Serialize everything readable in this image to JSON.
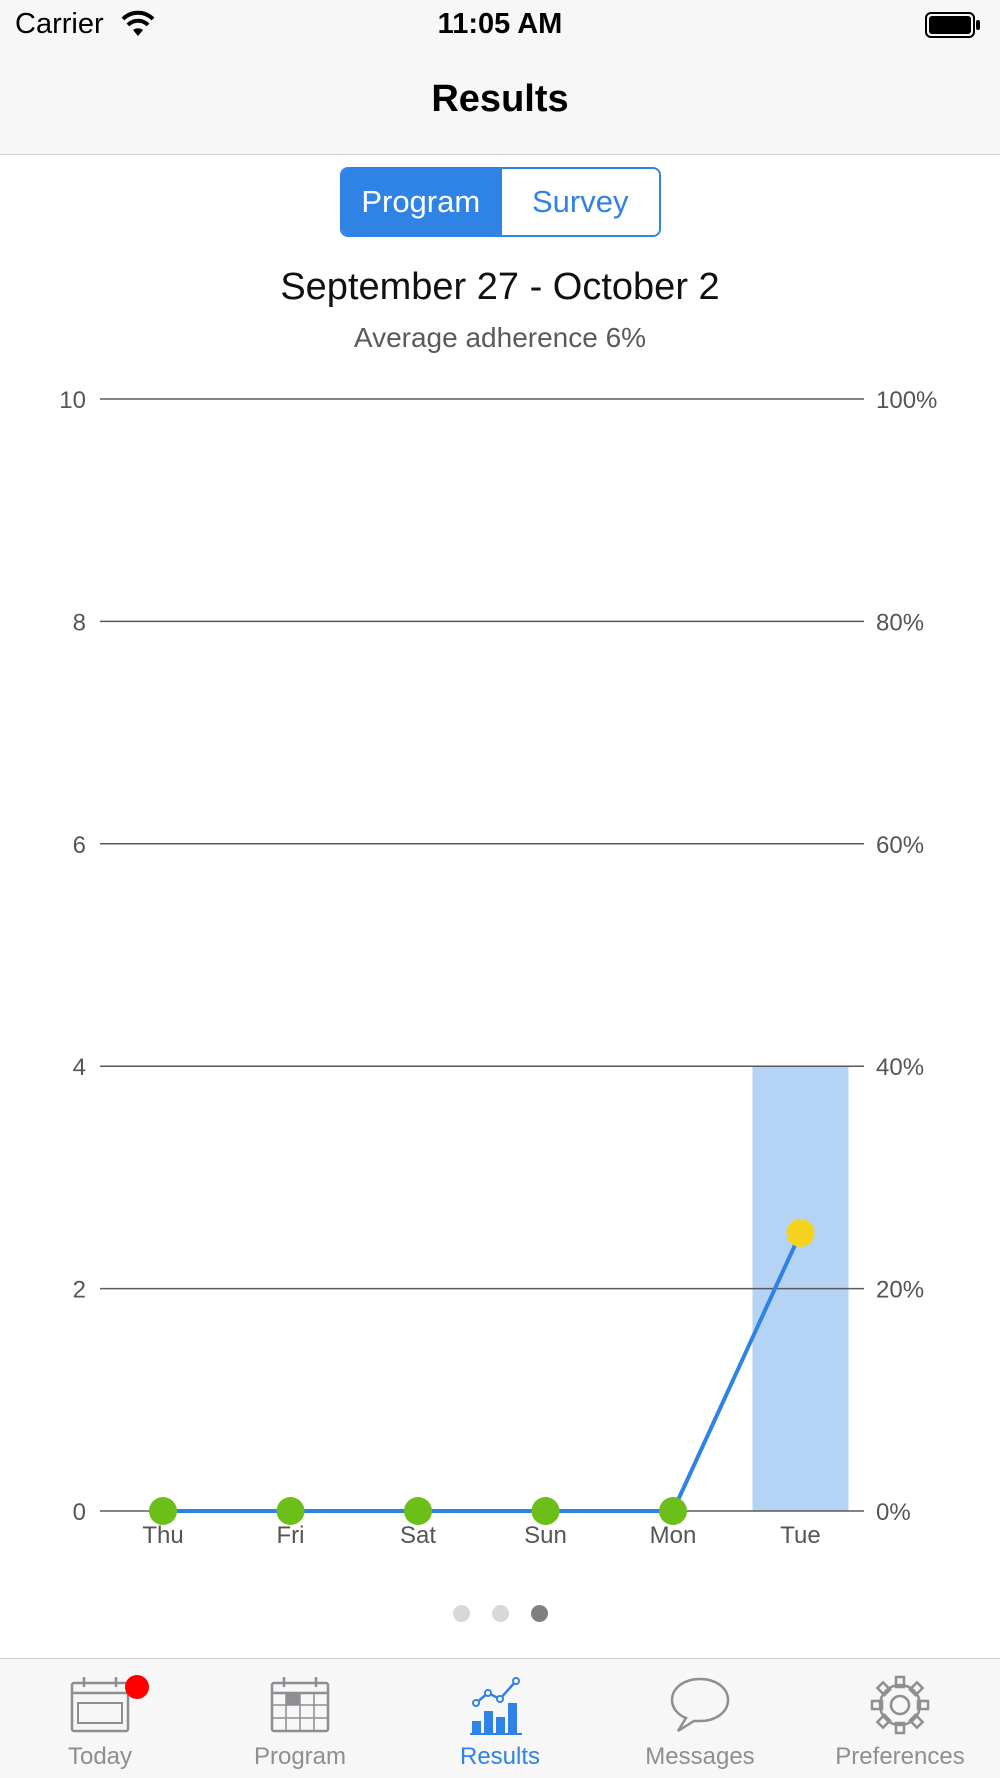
{
  "status_bar": {
    "carrier": "Carrier",
    "time": "11:05 AM"
  },
  "nav": {
    "title": "Results"
  },
  "segments": {
    "program": "Program",
    "survey": "Survey",
    "selected": "Program"
  },
  "header": {
    "date_range": "September 27 - October 2",
    "average": "Average adherence 6%"
  },
  "chart_data": {
    "type": "bar",
    "categories": [
      "Thu",
      "Fri",
      "Sat",
      "Sun",
      "Mon",
      "Tue"
    ],
    "series": [
      {
        "type": "bar",
        "axis": "left",
        "values": [
          0,
          0,
          0,
          0,
          0,
          4
        ],
        "color": "#b5d3f5"
      },
      {
        "type": "line",
        "axis": "right",
        "values": [
          0,
          0,
          0,
          0,
          0,
          25
        ],
        "color": "#2f83e4",
        "point_colors": [
          "#6cbe19",
          "#6cbe19",
          "#6cbe19",
          "#6cbe19",
          "#6cbe19",
          "#f5d31c"
        ]
      }
    ],
    "y_left": {
      "ticks": [
        "0",
        "2",
        "4",
        "6",
        "8",
        "10"
      ],
      "range": [
        0,
        10
      ]
    },
    "y_right": {
      "ticks": [
        "0%",
        "20%",
        "40%",
        "60%",
        "80%",
        "100%"
      ],
      "range": [
        0,
        100
      ]
    },
    "grid": true
  },
  "pager": {
    "pages": 3,
    "current": 3
  },
  "tabs": [
    {
      "label": "Today",
      "icon": "calendar-today-icon",
      "badge": true
    },
    {
      "label": "Program",
      "icon": "calendar-grid-icon"
    },
    {
      "label": "Results",
      "icon": "results-chart-icon",
      "active": true
    },
    {
      "label": "Messages",
      "icon": "speech-bubble-icon"
    },
    {
      "label": "Preferences",
      "icon": "gear-icon"
    }
  ],
  "colors": {
    "accent": "#2f83e4",
    "bar": "#b5d3f5",
    "point_ok": "#6cbe19",
    "point_warn": "#f5d31c",
    "badge": "#ff0000"
  }
}
